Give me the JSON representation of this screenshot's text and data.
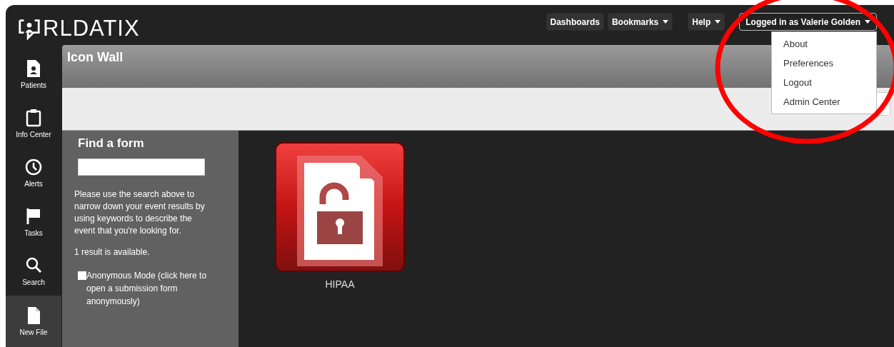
{
  "logo": {
    "text": "RLDATIX"
  },
  "nav_buttons": [
    {
      "label": "Dashboards",
      "has_caret": false
    },
    {
      "label": "Bookmarks",
      "has_caret": true
    },
    {
      "label": "Help",
      "has_caret": true
    },
    {
      "label": "Logged in as Valerie Golden",
      "has_caret": true,
      "expanded": true
    }
  ],
  "user_menu": [
    "About",
    "Preferences",
    "Logout",
    "Admin Center"
  ],
  "sidebar": {
    "items": [
      {
        "label": "Patients",
        "kind": "patients",
        "selected": false
      },
      {
        "label": "Info Center",
        "kind": "clipboard",
        "selected": false
      },
      {
        "label": "Alerts",
        "kind": "clock",
        "selected": false
      },
      {
        "label": "Tasks",
        "kind": "flag",
        "selected": false
      },
      {
        "label": "Search",
        "kind": "search",
        "selected": false
      },
      {
        "label": "New File",
        "kind": "file",
        "selected": true
      }
    ]
  },
  "page_title": "Icon Wall",
  "find_panel": {
    "title": "Find a form",
    "help": "Please use the search above to narrow down your event results by using keywords to describe the event that you're looking for.",
    "result_count": "1 result is available.",
    "anonymous": {
      "label": "Anonymous Mode (click here to open a submission form anonymously)",
      "checked": false
    }
  },
  "forms": [
    {
      "label": "HIPAA"
    }
  ]
}
